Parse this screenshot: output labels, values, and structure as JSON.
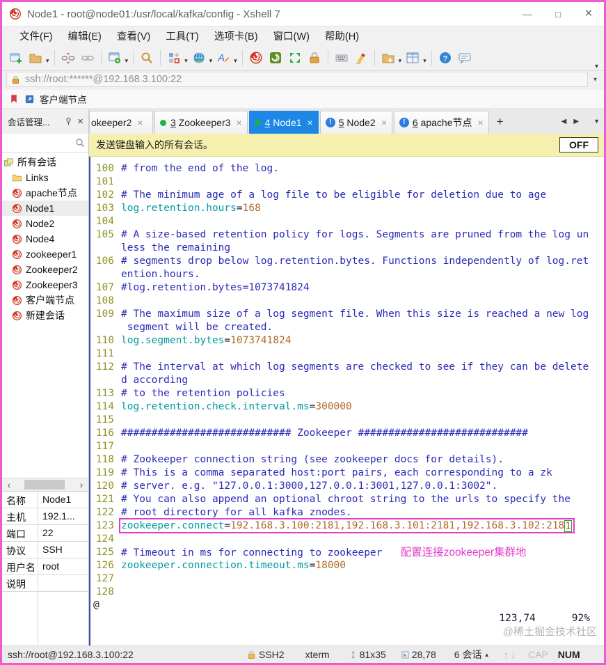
{
  "window": {
    "title": "Node1 - root@node01:/usr/local/kafka/config - Xshell 7",
    "controls": {
      "minimize": "—",
      "maximize": "□",
      "close": "×"
    }
  },
  "colors": {
    "frame_pink": "#ef59d2",
    "active_tab_blue": "#1d87e8",
    "banner_yellow": "#f6f0ae",
    "highlight_box_magenta": "#e03ccc",
    "cursor_green": "#2fa12f",
    "line_number_olive": "#8e9422",
    "comment_blue": "#2a2ab8",
    "key_teal": "#009aa0",
    "value_brown": "#ae6a28",
    "annotation_magenta": "#e23ccb"
  },
  "menu": {
    "items": [
      "文件(F)",
      "编辑(E)",
      "查看(V)",
      "工具(T)",
      "选项卡(B)",
      "窗口(W)",
      "帮助(H)"
    ]
  },
  "toolbar": {
    "items": [
      {
        "name": "new-session",
        "caret": false
      },
      {
        "name": "open",
        "caret": true
      },
      {
        "sep": true
      },
      {
        "name": "disconnect",
        "caret": false
      },
      {
        "name": "reconnect",
        "caret": false
      },
      {
        "sep": true
      },
      {
        "name": "properties",
        "caret": true
      },
      {
        "sep": true
      },
      {
        "name": "find",
        "caret": false
      },
      {
        "sep": true
      },
      {
        "name": "compose",
        "caret": true
      },
      {
        "name": "encoding",
        "caret": true
      },
      {
        "name": "font",
        "caret": true
      },
      {
        "sep": true
      },
      {
        "name": "xshell",
        "caret": false
      },
      {
        "name": "xftp",
        "caret": false
      },
      {
        "name": "fullscreen",
        "caret": false
      },
      {
        "name": "lock",
        "caret": false
      },
      {
        "sep": true
      },
      {
        "name": "keyboard",
        "caret": false
      },
      {
        "name": "highlight",
        "caret": false
      },
      {
        "sep": true
      },
      {
        "name": "new-folder",
        "caret": true
      },
      {
        "name": "tile",
        "caret": true
      },
      {
        "sep": true
      },
      {
        "name": "help",
        "caret": false
      },
      {
        "name": "feedback",
        "caret": false
      }
    ],
    "overflow_caret": "▾"
  },
  "address_bar": {
    "value": "ssh://root:******@192.168.3.100:22",
    "caret": "▾"
  },
  "quick_bar": {
    "label": "客户端节点"
  },
  "tabs": {
    "panel": {
      "title": "会话管理...",
      "close": "×"
    },
    "close_glyph": "×",
    "alert_glyph": "!",
    "new_tab": "+",
    "nav": {
      "left": "◀",
      "right": "▶",
      "menu": "▼"
    },
    "items": [
      {
        "num": "",
        "label": "okeeper2",
        "indicator": "none",
        "truncated": true
      },
      {
        "num": "3",
        "label": "Zookeeper3",
        "indicator": "green-dot"
      },
      {
        "num": "4",
        "label": "Node1",
        "indicator": "green-dot",
        "active": true
      },
      {
        "num": "5",
        "label": "Node2",
        "indicator": "alert"
      },
      {
        "num": "6",
        "label": "apache节点",
        "indicator": "alert"
      }
    ]
  },
  "sidebar": {
    "search_value": "",
    "scroll": {
      "left": "‹",
      "right": "›"
    },
    "items": [
      {
        "label": "所有会话",
        "icon": "root"
      },
      {
        "label": "Links",
        "icon": "folder"
      },
      {
        "label": "apache节点",
        "icon": "session"
      },
      {
        "label": "Node1",
        "icon": "session",
        "selected": true
      },
      {
        "label": "Node2",
        "icon": "session"
      },
      {
        "label": "Node4",
        "icon": "session"
      },
      {
        "label": "zookeeper1",
        "icon": "session"
      },
      {
        "label": "Zookeeper2",
        "icon": "session"
      },
      {
        "label": "Zookeeper3",
        "icon": "session"
      },
      {
        "label": "客户端节点",
        "icon": "session"
      },
      {
        "label": "新建会话",
        "icon": "session"
      }
    ]
  },
  "session_panel": {
    "rows": [
      {
        "key": "名称",
        "value": "Node1"
      },
      {
        "key": "主机",
        "value": "192.1..."
      },
      {
        "key": "端口",
        "value": "22"
      },
      {
        "key": "协议",
        "value": "SSH"
      },
      {
        "key": "用户名",
        "value": "root"
      },
      {
        "key": "说明",
        "value": ""
      }
    ]
  },
  "broadcast_banner": {
    "text": "发送键盘输入的所有会话。",
    "button": "OFF"
  },
  "terminal": {
    "lines": [
      {
        "num": "100",
        "parts": [
          {
            "t": "# from the end of the log.",
            "c": "comment"
          }
        ]
      },
      {
        "num": "101",
        "parts": []
      },
      {
        "num": "102",
        "parts": [
          {
            "t": "# The minimum age of a log file to be eligible for deletion due to age",
            "c": "comment"
          }
        ]
      },
      {
        "num": "103",
        "parts": [
          {
            "t": "log.retention.hours",
            "c": "key"
          },
          {
            "t": "=",
            "c": "eq"
          },
          {
            "t": "168",
            "c": "value"
          }
        ]
      },
      {
        "num": "104",
        "parts": []
      },
      {
        "num": "105",
        "parts": [
          {
            "t": "# A size-based retention policy for logs. Segments are pruned from the log un",
            "c": "comment"
          }
        ]
      },
      {
        "num": "",
        "parts": [
          {
            "t": "less the remaining",
            "c": "comment"
          }
        ]
      },
      {
        "num": "106",
        "parts": [
          {
            "t": "# segments drop below log.retention.bytes. Functions independently of log.ret",
            "c": "comment"
          }
        ]
      },
      {
        "num": "",
        "parts": [
          {
            "t": "ention.hours.",
            "c": "comment"
          }
        ]
      },
      {
        "num": "107",
        "parts": [
          {
            "t": "#log.retention.bytes=1073741824",
            "c": "comment"
          }
        ]
      },
      {
        "num": "108",
        "parts": []
      },
      {
        "num": "109",
        "parts": [
          {
            "t": "# The maximum size of a log segment file. When this size is reached a new log",
            "c": "comment"
          }
        ]
      },
      {
        "num": "",
        "parts": [
          {
            "t": " segment will be created.",
            "c": "comment"
          }
        ]
      },
      {
        "num": "110",
        "parts": [
          {
            "t": "log.segment.bytes",
            "c": "key"
          },
          {
            "t": "=",
            "c": "eq"
          },
          {
            "t": "1073741824",
            "c": "value"
          }
        ]
      },
      {
        "num": "111",
        "parts": []
      },
      {
        "num": "112",
        "parts": [
          {
            "t": "# The interval at which log segments are checked to see if they can be delete",
            "c": "comment"
          }
        ]
      },
      {
        "num": "",
        "parts": [
          {
            "t": "d according",
            "c": "comment"
          }
        ]
      },
      {
        "num": "113",
        "parts": [
          {
            "t": "# to the retention policies",
            "c": "comment"
          }
        ]
      },
      {
        "num": "114",
        "parts": [
          {
            "t": "log.retention.check.interval.ms",
            "c": "key"
          },
          {
            "t": "=",
            "c": "eq"
          },
          {
            "t": "300000",
            "c": "value"
          }
        ]
      },
      {
        "num": "115",
        "parts": []
      },
      {
        "num": "116",
        "parts": [
          {
            "t": "############################ Zookeeper ############################",
            "c": "comment"
          }
        ]
      },
      {
        "num": "117",
        "parts": []
      },
      {
        "num": "118",
        "parts": [
          {
            "t": "# Zookeeper connection string (see zookeeper docs for details).",
            "c": "comment"
          }
        ]
      },
      {
        "num": "119",
        "parts": [
          {
            "t": "# This is a comma separated host:port pairs, each corresponding to a zk",
            "c": "comment"
          }
        ]
      },
      {
        "num": "120",
        "parts": [
          {
            "t": "# server. e.g. \"127.0.0.1:3000,127.0.0.1:3001,127.0.0.1:3002\".",
            "c": "comment"
          }
        ]
      },
      {
        "num": "121",
        "parts": [
          {
            "t": "# You can also append an optional chroot string to the urls to specify the",
            "c": "comment"
          }
        ]
      },
      {
        "num": "122",
        "parts": [
          {
            "t": "# root directory for all kafka znodes.",
            "c": "comment"
          }
        ]
      },
      {
        "num": "123",
        "box": true,
        "parts": [
          {
            "t": "zookeeper.connect",
            "c": "key"
          },
          {
            "t": "=",
            "c": "eq"
          },
          {
            "t": "192.168.3.100:2181,192.168.3.101:2181,192.168.3.102:218",
            "c": "value"
          },
          {
            "t": "1",
            "c": "cursor"
          }
        ]
      },
      {
        "num": "124",
        "parts": []
      },
      {
        "num": "125",
        "parts": [
          {
            "t": "# Timeout in ms for connecting to zookeeper",
            "c": "comment"
          },
          {
            "t": "   ",
            "c": "plain"
          },
          {
            "t": "配置连接zookeeper集群地",
            "c": "annot"
          }
        ]
      },
      {
        "num": "126",
        "parts": [
          {
            "t": "zookeeper.connection.timeout.ms",
            "c": "key"
          },
          {
            "t": "=",
            "c": "eq"
          },
          {
            "t": "18000",
            "c": "value"
          }
        ]
      },
      {
        "num": "127",
        "parts": []
      },
      {
        "num": "128",
        "parts": []
      },
      {
        "num": "@",
        "at": true,
        "parts": []
      }
    ],
    "ruler": {
      "position": "123,74",
      "percent": "92%"
    },
    "watermark": "@稀土掘金技术社区"
  },
  "status_bar": {
    "url": "ssh://root@192.168.3.100:22",
    "protocol": "SSH2",
    "term_type": "xterm",
    "size": "81x35",
    "cursor_pos": "28,78",
    "sessions": "6 会话",
    "sessions_caret": "▴",
    "up": "↑",
    "down": "↓",
    "cap": "CAP",
    "num": "NUM"
  }
}
